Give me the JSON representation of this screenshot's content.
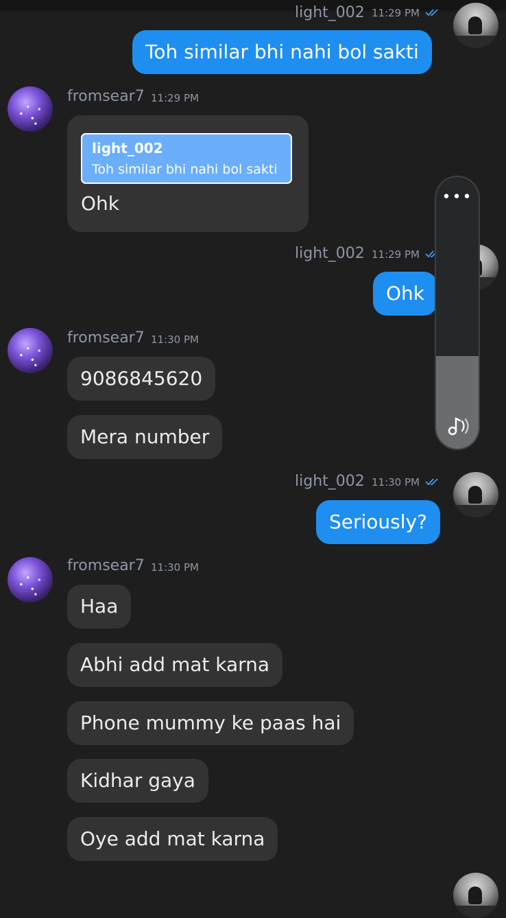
{
  "colors": {
    "outgoing_bubble": "#1e8ef0",
    "incoming_bubble": "#333334",
    "background": "#1e1e1f",
    "quote_bg": "#6aaefc",
    "read_tick": "#3e9cf2"
  },
  "messages": [
    {
      "sender": "light_002",
      "time": "11:29 PM",
      "direction": "outgoing",
      "text": "Toh similar bhi nahi bol sakti"
    },
    {
      "sender": "fromsear7",
      "time": "11:29 PM",
      "direction": "incoming",
      "reply_to": {
        "name": "light_002",
        "text": "Toh similar bhi nahi bol sakti"
      },
      "text": "Ohk"
    },
    {
      "sender": "light_002",
      "time": "11:29 PM",
      "direction": "outgoing",
      "text": "Ohk"
    },
    {
      "sender": "fromsear7",
      "time": "11:30 PM",
      "direction": "incoming",
      "texts": [
        "9086845620",
        "Mera number"
      ]
    },
    {
      "sender": "light_002",
      "time": "11:30 PM",
      "direction": "outgoing",
      "text": "Seriously?"
    },
    {
      "sender": "fromsear7",
      "time": "11:30 PM",
      "direction": "incoming",
      "texts": [
        "Haa",
        "Abhi add mat karna",
        "Phone mummy ke paas hai",
        "Kidhar gaya",
        "Oye add mat karna"
      ]
    }
  ],
  "volume_panel": {
    "level_percent": 34,
    "more_icon": "more-icon",
    "music_icon": "music-volume-icon"
  }
}
